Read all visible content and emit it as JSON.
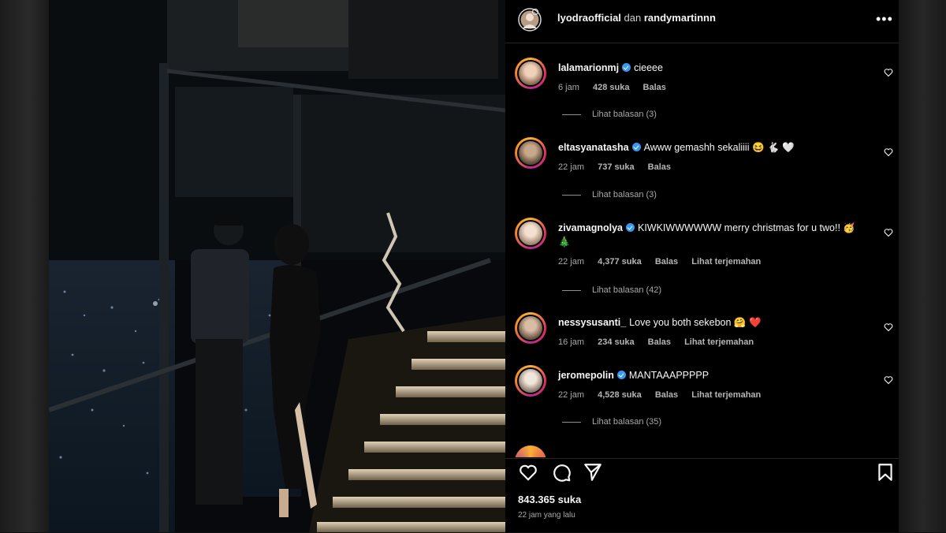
{
  "post": {
    "owner_user": "lyodraofficial",
    "joiner": "dan",
    "collab_user": "randymartinnn",
    "more_label": "•••"
  },
  "comments": [
    {
      "user": "lalamarionmj",
      "verified": true,
      "text": "cieeee",
      "time": "6 jam",
      "likes": "428 suka",
      "reply": "Balas",
      "translate": "",
      "view_replies": "Lihat balasan (3)"
    },
    {
      "user": "eltasyanatasha",
      "verified": true,
      "text": "Awww gemashh sekaliiii 😆 🐇 🤍",
      "time": "22 jam",
      "likes": "737 suka",
      "reply": "Balas",
      "translate": "",
      "view_replies": "Lihat balasan (3)"
    },
    {
      "user": "zivamagnolya",
      "verified": true,
      "text": "KIWKIWWWWWW merry christmas for u two!! 🥳 🎄",
      "time": "22 jam",
      "likes": "4,377 suka",
      "reply": "Balas",
      "translate": "Lihat terjemahan",
      "view_replies": "Lihat balasan (42)"
    },
    {
      "user": "nessysusanti_",
      "verified": false,
      "text": "Love you both sekebon 🤗 ❤️",
      "time": "16 jam",
      "likes": "234 suka",
      "reply": "Balas",
      "translate": "Lihat terjemahan",
      "view_replies": ""
    },
    {
      "user": "jeromepolin",
      "verified": true,
      "text": "MANTAAAPPPPP",
      "time": "22 jam",
      "likes": "4,528 suka",
      "reply": "Balas",
      "translate": "Lihat terjemahan",
      "view_replies": "Lihat balasan (35)"
    }
  ],
  "footer": {
    "likes_count": "843.365 suka",
    "time_ago": "22 jam yang lalu"
  },
  "icons": {
    "like": "heart-icon",
    "comment": "comment-icon",
    "share": "send-icon",
    "save": "bookmark-icon",
    "comment_like": "heart-outline-icon",
    "more": "more-dots-icon"
  },
  "colors": {
    "background": "#000000",
    "text": "#f5f5f5",
    "muted": "#a8a8a8",
    "verified": "#3897f0",
    "divider": "#262626",
    "heart_red": "#ed4956"
  }
}
